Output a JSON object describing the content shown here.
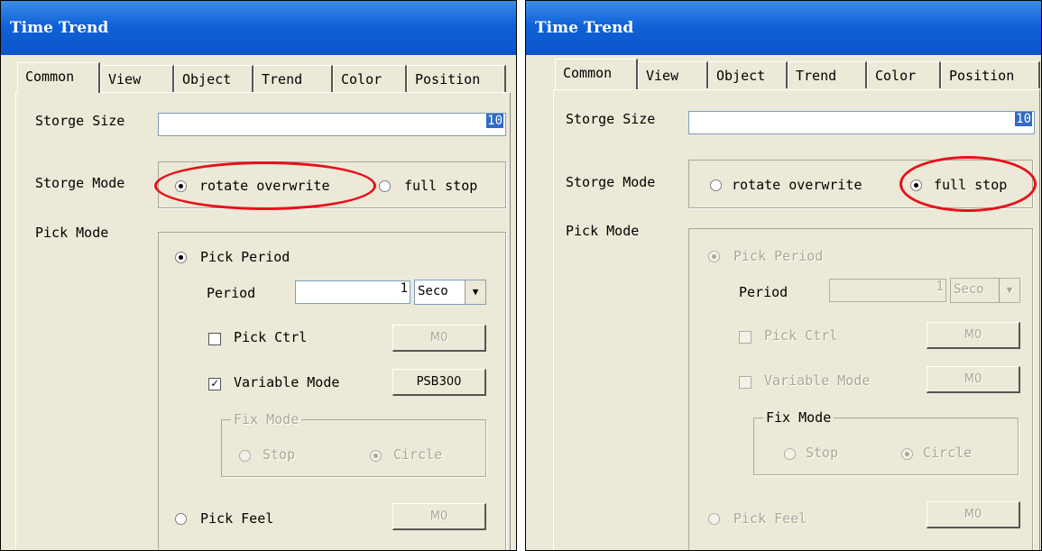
{
  "dialog_left": {
    "title": "Time Trend",
    "tabs": [
      "Common",
      "View",
      "Object",
      "Trend",
      "Color",
      "Position"
    ],
    "storage_size_label": "Storge Size",
    "storage_size_value": "10",
    "storage_mode_label": "Storge Mode",
    "storage_mode_options": [
      "rotate overwrite",
      "full stop"
    ],
    "storage_mode_selected": "rotate overwrite",
    "pick_mode_label": "Pick Mode",
    "pick_period_label": "Pick Period",
    "period_label": "Period",
    "period_value": "1",
    "period_unit": "Seco",
    "pick_ctrl_label": "Pick Ctrl",
    "pick_ctrl_button": "M0",
    "variable_mode_label": "Variable Mode",
    "variable_mode_checked": true,
    "variable_mode_button": "PSB300",
    "fix_mode_label": "Fix Mode",
    "fix_mode_options": [
      "Stop",
      "Circle"
    ],
    "pick_feel_label": "Pick Feel",
    "pick_feel_button": "M0"
  },
  "dialog_right": {
    "title": "Time Trend",
    "tabs": [
      "Common",
      "View",
      "Object",
      "Trend",
      "Color",
      "Position"
    ],
    "storage_size_label": "Storge Size",
    "storage_size_value": "10",
    "storage_mode_label": "Storge Mode",
    "storage_mode_options": [
      "rotate overwrite",
      "full stop"
    ],
    "storage_mode_selected": "full stop",
    "pick_mode_label": "Pick Mode",
    "pick_period_label": "Pick Period",
    "period_label": "Period",
    "period_value": "1",
    "period_unit": "Seco",
    "pick_ctrl_label": "Pick Ctrl",
    "pick_ctrl_button": "M0",
    "variable_mode_label": "Variable Mode",
    "variable_mode_checked": false,
    "variable_mode_button": "M0",
    "fix_mode_label": "Fix Mode",
    "fix_mode_options": [
      "Stop",
      "Circle"
    ],
    "pick_feel_label": "Pick Feel",
    "pick_feel_button": "M0"
  },
  "colors": {
    "titlebar": "#0a55c8",
    "dialog_bg": "#ece9d8",
    "highlight": "#e8101a",
    "selection": "#316ac5"
  }
}
